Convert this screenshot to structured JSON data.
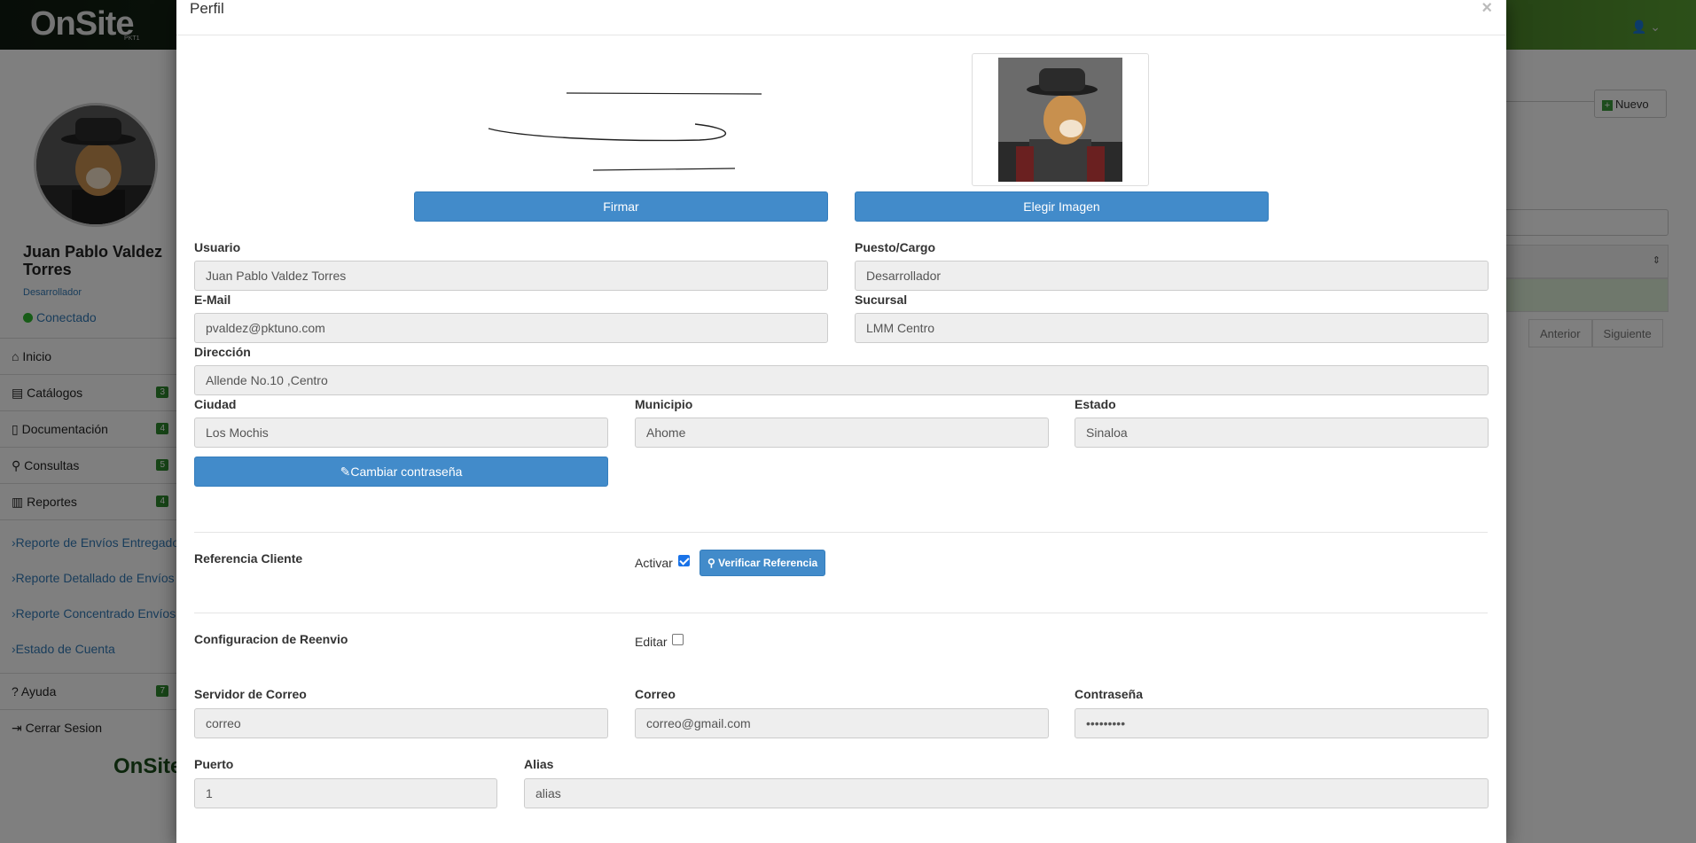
{
  "app": {
    "brand": "OnSite",
    "brand_sub": "PKT1",
    "footer_logo": "OnSite"
  },
  "user": {
    "name": "Juan Pablo Valdez Torres",
    "role": "Desarrollador",
    "status": "Conectado"
  },
  "sidebar": {
    "items": [
      {
        "label": "Inicio",
        "icon": "home-icon",
        "badge": ""
      },
      {
        "label": "Catálogos",
        "icon": "book-icon",
        "badge": "3"
      },
      {
        "label": "Documentación",
        "icon": "file-icon",
        "badge": "4"
      },
      {
        "label": "Consultas",
        "icon": "search-icon",
        "badge": "5"
      },
      {
        "label": "Reportes",
        "icon": "bar-chart-icon",
        "badge": "4"
      }
    ],
    "sub_items": [
      {
        "label": "›Reporte de Envíos Entregados"
      },
      {
        "label": "›Reporte Detallado de Envíos"
      },
      {
        "label": "›Reporte Concentrado Envíos"
      },
      {
        "label": "›Estado de Cuenta"
      }
    ],
    "bottom_items": [
      {
        "label": "Ayuda",
        "icon": "question-icon",
        "badge": "7"
      },
      {
        "label": "Cerrar Sesion",
        "icon": "sign-out-icon",
        "badge": ""
      }
    ]
  },
  "background": {
    "new_button": "Nuevo",
    "pager_prev": "Anterior",
    "pager_next": "Siguiente"
  },
  "modal": {
    "title": "Perfil",
    "close": "×",
    "sign_button": "Firmar",
    "choose_image_button": "Elegir Imagen",
    "fields": {
      "usuario": {
        "label": "Usuario",
        "value": "Juan Pablo Valdez Torres"
      },
      "puesto": {
        "label": "Puesto/Cargo",
        "value": "Desarrollador"
      },
      "email": {
        "label": "E-Mail",
        "value": "pvaldez@pktuno.com"
      },
      "sucursal": {
        "label": "Sucursal",
        "value": "LMM Centro"
      },
      "direccion": {
        "label": "Dirección",
        "value": "Allende No.10 ,Centro"
      },
      "ciudad": {
        "label": "Ciudad",
        "value": "Los Mochis"
      },
      "municipio": {
        "label": "Municipio",
        "value": "Ahome"
      },
      "estado": {
        "label": "Estado",
        "value": "Sinaloa"
      }
    },
    "change_password_button": "Cambiar contraseña",
    "referencia": {
      "label": "Referencia Cliente",
      "activar_label": "Activar",
      "activar_checked": true,
      "verify_button": "Verificar Referencia"
    },
    "reenvio": {
      "label": "Configuracion de Reenvio",
      "editar_label": "Editar",
      "editar_checked": false
    },
    "mail": {
      "servidor": {
        "label": "Servidor de Correo",
        "value": "correo"
      },
      "correo": {
        "label": "Correo",
        "value": "correo@gmail.com"
      },
      "password": {
        "label": "Contraseña",
        "value": "•••••••••"
      },
      "puerto": {
        "label": "Puerto",
        "value": "1"
      },
      "alias": {
        "label": "Alias",
        "value": "alias"
      }
    }
  }
}
